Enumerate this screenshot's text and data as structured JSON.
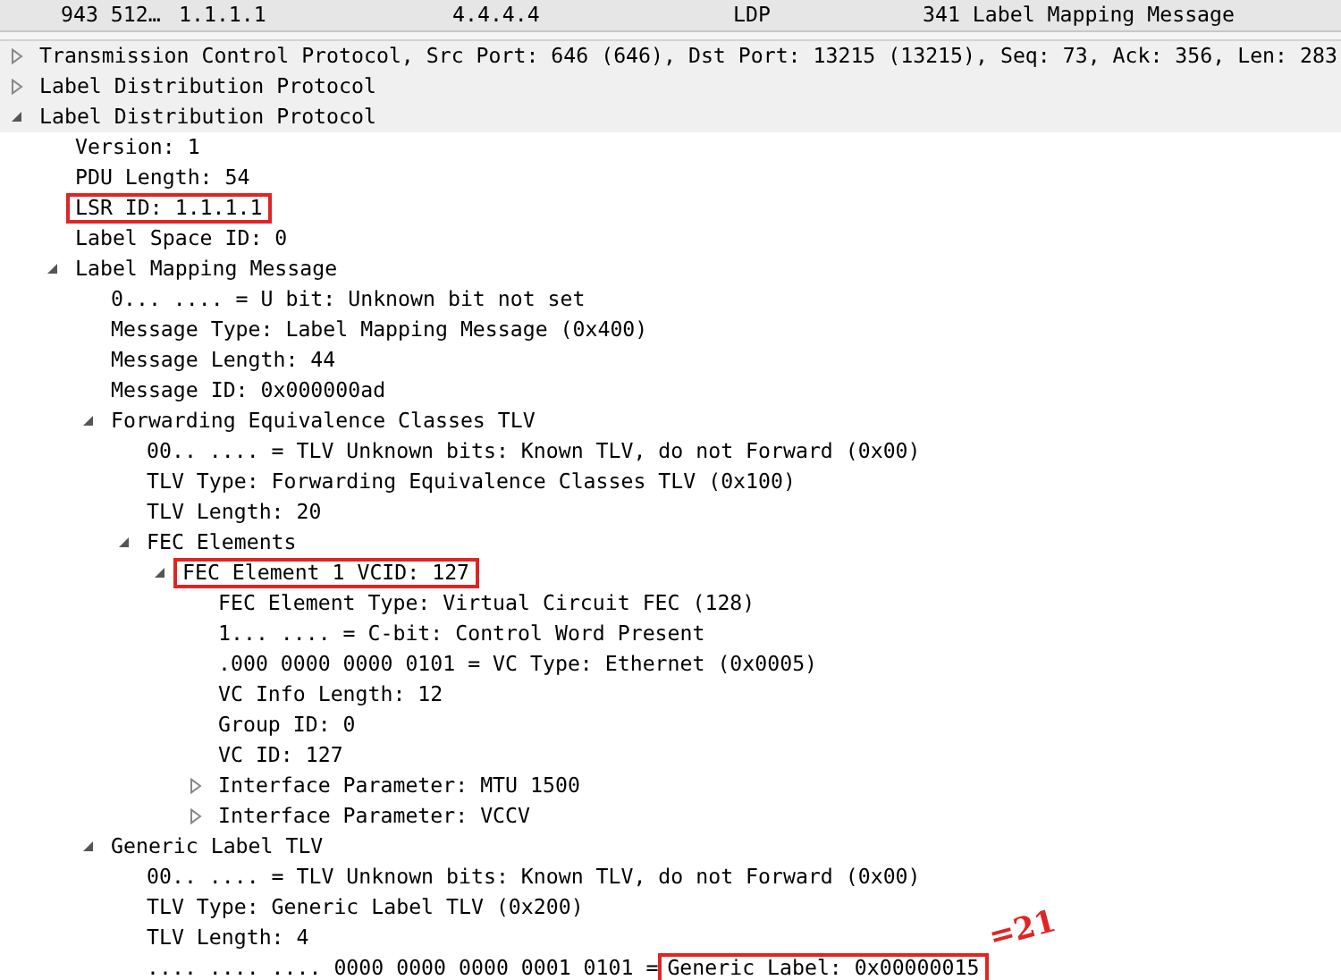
{
  "packet_row": {
    "columns": [
      "943 512…",
      "1.1.1.1",
      "4.4.4.4",
      "LDP",
      "341 Label Mapping Message"
    ]
  },
  "tree": [
    {
      "text": "Transmission Control Protocol, Src Port: 646 (646), Dst Port: 13215 (13215), Seq: 73, Ack: 356, Len: 283",
      "expanded": false
    },
    {
      "text": "Label Distribution Protocol",
      "expanded": false
    },
    {
      "text": "Label Distribution Protocol",
      "expanded": true,
      "children": [
        {
          "text": "Version: 1"
        },
        {
          "text": "PDU Length: 54"
        },
        {
          "text": "LSR ID: 1.1.1.1",
          "boxed": true
        },
        {
          "text": "Label Space ID: 0"
        },
        {
          "text": "Label Mapping Message",
          "expanded": true,
          "children": [
            {
              "text": "0... .... = U bit: Unknown bit not set"
            },
            {
              "text": "Message Type: Label Mapping Message (0x400)"
            },
            {
              "text": "Message Length: 44"
            },
            {
              "text": "Message ID: 0x000000ad"
            },
            {
              "text": "Forwarding Equivalence Classes TLV",
              "expanded": true,
              "children": [
                {
                  "text": "00.. .... = TLV Unknown bits: Known TLV, do not Forward (0x00)"
                },
                {
                  "text": "TLV Type: Forwarding Equivalence Classes TLV (0x100)"
                },
                {
                  "text": "TLV Length: 20"
                },
                {
                  "text": "FEC Elements",
                  "expanded": true,
                  "children": [
                    {
                      "text": "FEC Element 1 VCID: 127",
                      "boxed": true,
                      "expanded": true,
                      "children": [
                        {
                          "text": "FEC Element Type: Virtual Circuit FEC (128)"
                        },
                        {
                          "text": "1... .... = C-bit: Control Word Present"
                        },
                        {
                          "text": ".000 0000 0000 0101 = VC Type: Ethernet (0x0005)"
                        },
                        {
                          "text": "VC Info Length: 12"
                        },
                        {
                          "text": "Group ID: 0"
                        },
                        {
                          "text": "VC ID: 127"
                        },
                        {
                          "text": "Interface Parameter: MTU 1500",
                          "expanded": false
                        },
                        {
                          "text": "Interface Parameter: VCCV",
                          "expanded": false
                        }
                      ]
                    }
                  ]
                }
              ]
            },
            {
              "text": "Generic Label TLV",
              "expanded": true,
              "children": [
                {
                  "text": "00.. .... = TLV Unknown bits: Known TLV, do not Forward (0x00)"
                },
                {
                  "text": "TLV Type: Generic Label TLV (0x200)"
                },
                {
                  "text": "TLV Length: 4"
                },
                {
                  "text": ".... .... .... 0000 0000 0000 0001 0101 = ",
                  "boxed_text": "Generic Label: 0x00000015",
                  "note": "=21"
                }
              ]
            }
          ]
        }
      ]
    }
  ]
}
